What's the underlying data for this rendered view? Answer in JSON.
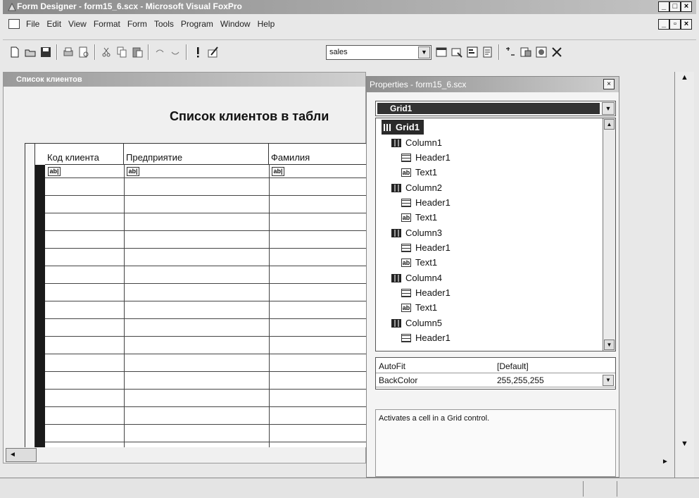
{
  "app": {
    "title": "Form Designer - form15_6.scx - Microsoft Visual FoxPro"
  },
  "menu": [
    "File",
    "Edit",
    "View",
    "Format",
    "Form",
    "Tools",
    "Program",
    "Window",
    "Help"
  ],
  "toolbar": {
    "combo_value": "sales"
  },
  "form": {
    "caption": "Список клиентов",
    "heading": "Список клиентов в табли",
    "grid": {
      "columns": [
        "Код клиента",
        "Предприятие",
        "Фамилия"
      ],
      "cell_placeholder": "ab|"
    }
  },
  "properties": {
    "title": "Properties - form15_6.scx",
    "object": "Grid1",
    "tree": [
      {
        "label": "Grid1",
        "kind": "grid",
        "selected": true
      },
      {
        "label": "Column1",
        "kind": "column"
      },
      {
        "label": "Header1",
        "kind": "header"
      },
      {
        "label": "Text1",
        "kind": "text"
      },
      {
        "label": "Column2",
        "kind": "column"
      },
      {
        "label": "Header1",
        "kind": "header"
      },
      {
        "label": "Text1",
        "kind": "text"
      },
      {
        "label": "Column3",
        "kind": "column"
      },
      {
        "label": "Header1",
        "kind": "header"
      },
      {
        "label": "Text1",
        "kind": "text"
      },
      {
        "label": "Column4",
        "kind": "column"
      },
      {
        "label": "Header1",
        "kind": "header"
      },
      {
        "label": "Text1",
        "kind": "text"
      },
      {
        "label": "Column5",
        "kind": "column"
      },
      {
        "label": "Header1",
        "kind": "header"
      }
    ],
    "rows": [
      {
        "name": "AutoFit",
        "value": "[Default]"
      },
      {
        "name": "BackColor",
        "value": "255,255,255"
      }
    ],
    "description": "Activates a cell in a Grid control."
  }
}
